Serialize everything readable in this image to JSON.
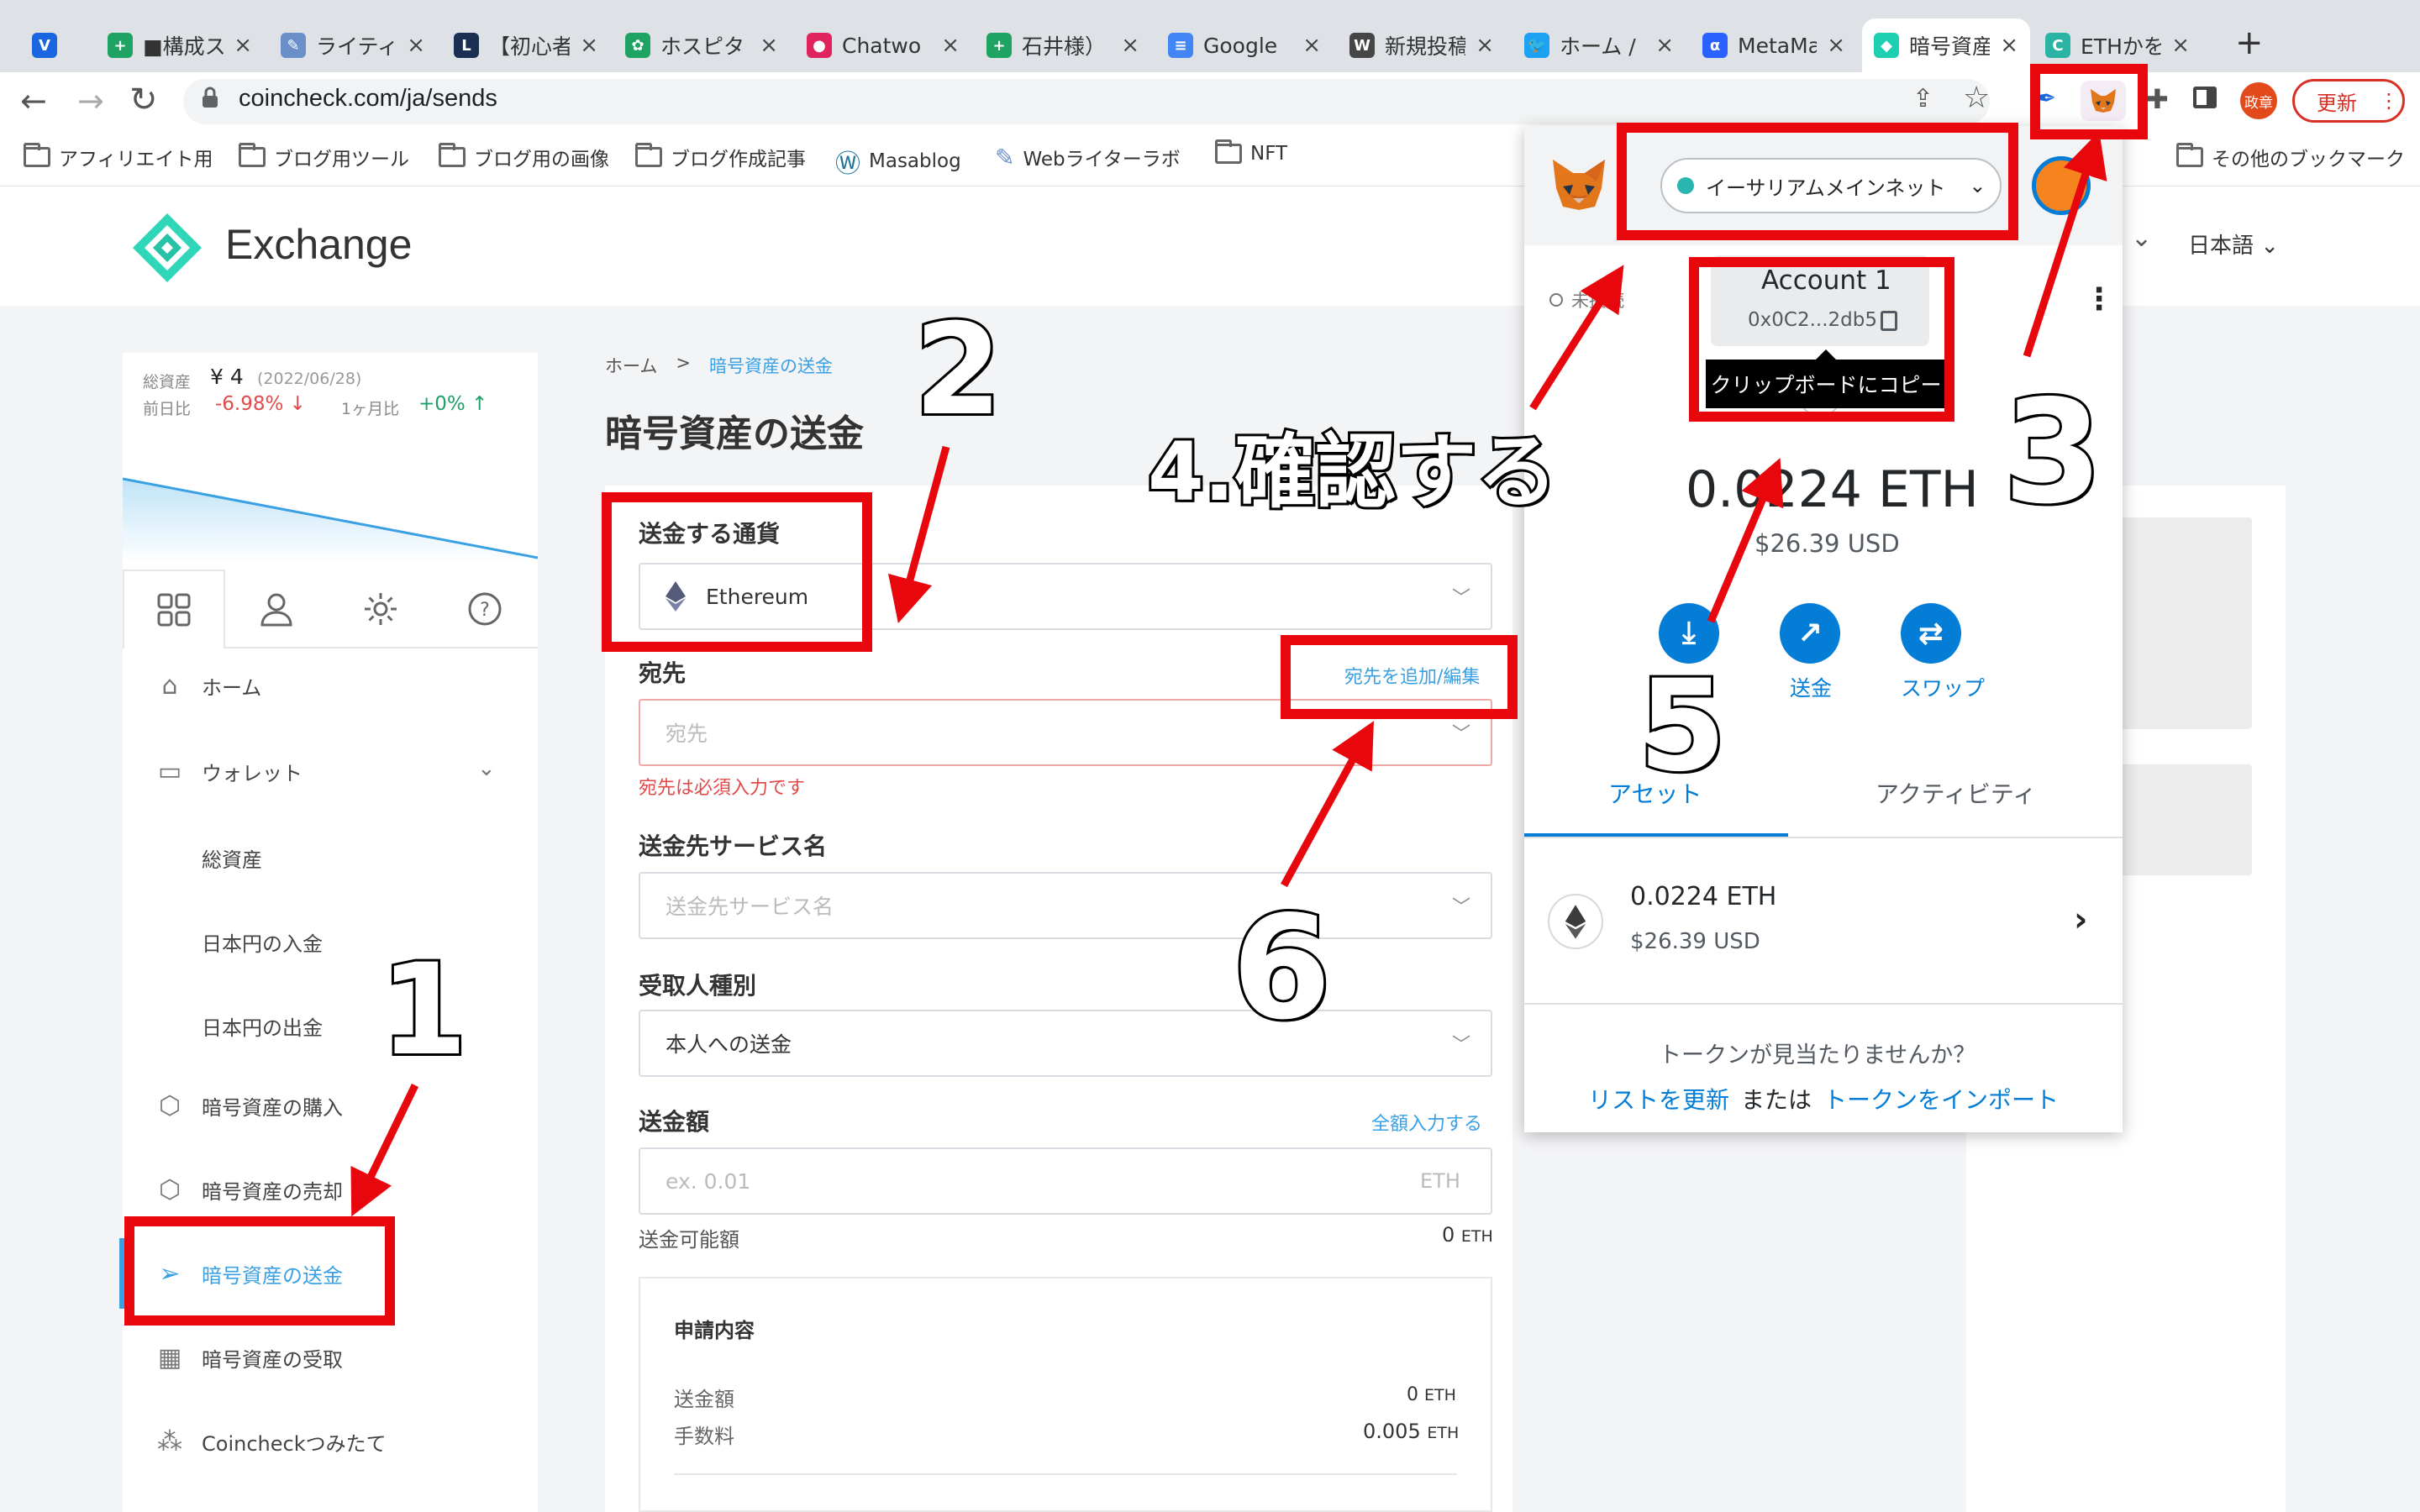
{
  "browser": {
    "tabs": [
      {
        "title": "",
        "fav": "V",
        "color": "#1a66e0"
      },
      {
        "title": "■構成ス",
        "fav": "+",
        "color": "#1ea362"
      },
      {
        "title": "ライティ",
        "fav": "✎",
        "color": "#6a8fc9"
      },
      {
        "title": "【初心者",
        "fav": "L",
        "color": "#1b2f52"
      },
      {
        "title": "ホスピタ",
        "fav": "✿",
        "color": "#1ea362"
      },
      {
        "title": "Chatwo",
        "fav": "●",
        "color": "#e0245e"
      },
      {
        "title": "石井様）",
        "fav": "+",
        "color": "#1ea362"
      },
      {
        "title": "Google",
        "fav": "≡",
        "color": "#4285f4"
      },
      {
        "title": "新規投稿",
        "fav": "W",
        "color": "#464646"
      },
      {
        "title": "ホーム /",
        "fav": "🐦",
        "color": "#1da1f2"
      },
      {
        "title": "MetaMa",
        "fav": "α",
        "color": "#2962ff"
      },
      {
        "title": "暗号資産",
        "fav": "◆",
        "color": "#1fcfb1"
      },
      {
        "title": "ETHかを",
        "fav": "C",
        "color": "#2bb3a3"
      }
    ],
    "url": "coincheck.com/ja/sends",
    "profile_initials": "政章",
    "update_label": "更新",
    "bookmarks": [
      {
        "label": "アフィリエイト用",
        "type": "folder"
      },
      {
        "label": "ブログ用ツール",
        "type": "folder"
      },
      {
        "label": "ブログ用の画像",
        "type": "folder"
      },
      {
        "label": "ブログ作成記事",
        "type": "folder"
      },
      {
        "label": "Masablog",
        "type": "wordpress"
      },
      {
        "label": "Webライターラボ",
        "type": "pen"
      },
      {
        "label": "NFT",
        "type": "folder"
      }
    ],
    "other_bookmarks": "その他のブックマーク"
  },
  "site": {
    "logo_text": "Exchange",
    "language": "日本語"
  },
  "sidebar": {
    "asset_label": "総資産",
    "asset_value": "¥ 4",
    "asset_date": "(2022/06/28)",
    "day_label": "前日比",
    "day_value": "-6.98% ↓",
    "month_label": "1ヶ月比",
    "month_value": "+0% ↑",
    "nav": {
      "home": "ホーム",
      "wallet": "ウォレット",
      "total_assets": "総資産",
      "jpy_deposit": "日本円の入金",
      "jpy_withdraw": "日本円の出金",
      "buy": "暗号資産の購入",
      "sell": "暗号資産の売却",
      "send": "暗号資産の送金",
      "receive": "暗号資産の受取",
      "tsumitate": "Coincheckつみたて"
    }
  },
  "main": {
    "breadcrumb_home": "ホーム",
    "breadcrumb_sep": ">",
    "breadcrumb_current": "暗号資産の送金",
    "title": "暗号資産の送金",
    "currency_label": "送金する通貨",
    "currency_value": "Ethereum",
    "dest_label": "宛先",
    "dest_edit_link": "宛先を追加/編集",
    "dest_placeholder": "宛先",
    "dest_error": "宛先は必須入力です",
    "service_label": "送金先サービス名",
    "service_placeholder": "送金先サービス名",
    "recipient_type_label": "受取人種別",
    "recipient_type_value": "本人への送金",
    "amount_label": "送金額",
    "fill_all_link": "全額入力する",
    "amount_placeholder": "ex. 0.01",
    "amount_unit": "ETH",
    "available_label": "送金可能額",
    "available_value": "0",
    "available_unit": "ETH",
    "summary_title": "申請内容",
    "summary_amount_label": "送金額",
    "summary_amount_value": "0",
    "summary_amount_unit": "ETH",
    "summary_fee_label": "手数料",
    "summary_fee_value": "0.005",
    "summary_fee_unit": "ETH"
  },
  "metamask": {
    "network": "イーサリアムメインネット",
    "connection_status": "未接続",
    "account_name": "Account 1",
    "address": "0x0C2...2db5",
    "tooltip": "クリップボードにコピー",
    "balance": "0.0224 ETH",
    "balance_usd": "$26.39 USD",
    "actions": {
      "buy": "",
      "send": "送金",
      "swap": "スワップ"
    },
    "tabs": {
      "assets": "アセット",
      "activity": "アクティビティ"
    },
    "token_amount": "0.0224 ETH",
    "token_usd": "$26.39 USD",
    "missing_tokens": "トークンが見当たりませんか？",
    "refresh_list": "リストを更新",
    "or": "または",
    "import_tokens": "トークンをインポート"
  },
  "annotations": {
    "n1": "1",
    "n2": "2",
    "n3": "3",
    "n4": "4.確認する",
    "n5": "5",
    "n6": "6",
    "color": "#e8070c"
  }
}
